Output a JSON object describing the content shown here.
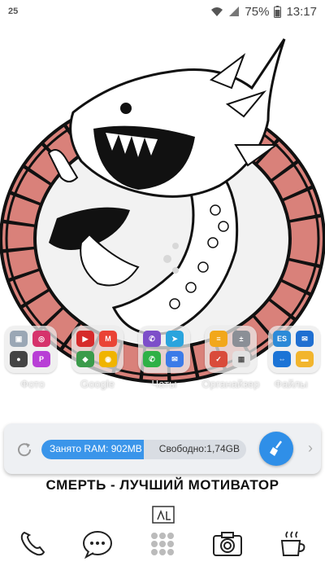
{
  "status_bar": {
    "notification_count": "25",
    "battery": "75%",
    "time": "13:17"
  },
  "folders": [
    {
      "label": "Фото",
      "icons": [
        "gallery-icon",
        "instagram-icon",
        "camera-icon",
        "picsart-icon"
      ]
    },
    {
      "label": "Google",
      "icons": [
        "youtube-icon",
        "gmail-icon",
        "maps-icon",
        "chrome-icon"
      ]
    },
    {
      "label": "Чаты",
      "icons": [
        "viber-icon",
        "telegram-icon",
        "whatsapp-icon",
        "messenger-icon"
      ]
    },
    {
      "label": "Органайзер",
      "icons": [
        "notes-icon",
        "calculator-icon",
        "tasks-icon",
        "calendar-icon"
      ]
    },
    {
      "label": "Файлы",
      "icons": [
        "es-explorer-icon",
        "mail-icon",
        "teamviewer-icon",
        "files-icon"
      ]
    }
  ],
  "ram_widget": {
    "used_label": "Занято RAM: 902MB",
    "free_label": "Свободно:1,74GB",
    "used_fraction": 0.5
  },
  "motto": "СМЕРТЬ - ЛУЧШИЙ МОТИВАТОР",
  "dock": [
    "phone-icon",
    "messages-icon",
    "apps-icon",
    "camera-icon",
    "coffee-icon"
  ],
  "colors": {
    "accent": "#2f8fe8",
    "ring": "#d9817a",
    "ink": "#111111"
  }
}
